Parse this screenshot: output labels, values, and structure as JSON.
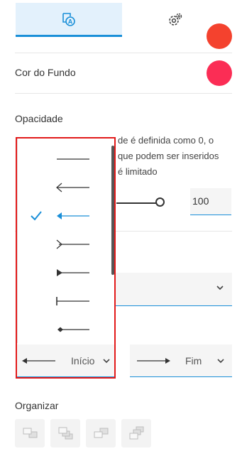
{
  "colors": {
    "accent": "#1a8fd8",
    "bg_color_top": "#f4422e",
    "bg_color": "#fb2d55",
    "highlight_border": "#e21a1a"
  },
  "tabs": [
    {
      "icon": "text-style-icon",
      "active": true
    },
    {
      "icon": "gear-icon",
      "active": false
    }
  ],
  "background": {
    "label": "Cor do Fundo"
  },
  "opacity": {
    "label": "Opacidade",
    "help_lines": [
      "de é definida como 0, o",
      "que podem ser inseridos",
      "é limitado"
    ],
    "value": "100",
    "slider_percent": 100
  },
  "arrow_dropdown": {
    "options": [
      {
        "icon": "line-no-arrow-icon"
      },
      {
        "icon": "line-open-arrow-icon"
      },
      {
        "icon": "line-filled-arrow-icon",
        "selected": true
      },
      {
        "icon": "line-chevron-icon"
      },
      {
        "icon": "line-triangle-end-icon"
      },
      {
        "icon": "line-bar-end-icon"
      },
      {
        "icon": "line-diamond-end-icon"
      }
    ]
  },
  "arrows": {
    "start_label": "Início",
    "end_label": "Fim"
  },
  "organize": {
    "label": "Organizar",
    "buttons": [
      "bring-forward-icon",
      "bring-to-front-icon",
      "send-backward-icon",
      "send-to-back-icon"
    ]
  }
}
